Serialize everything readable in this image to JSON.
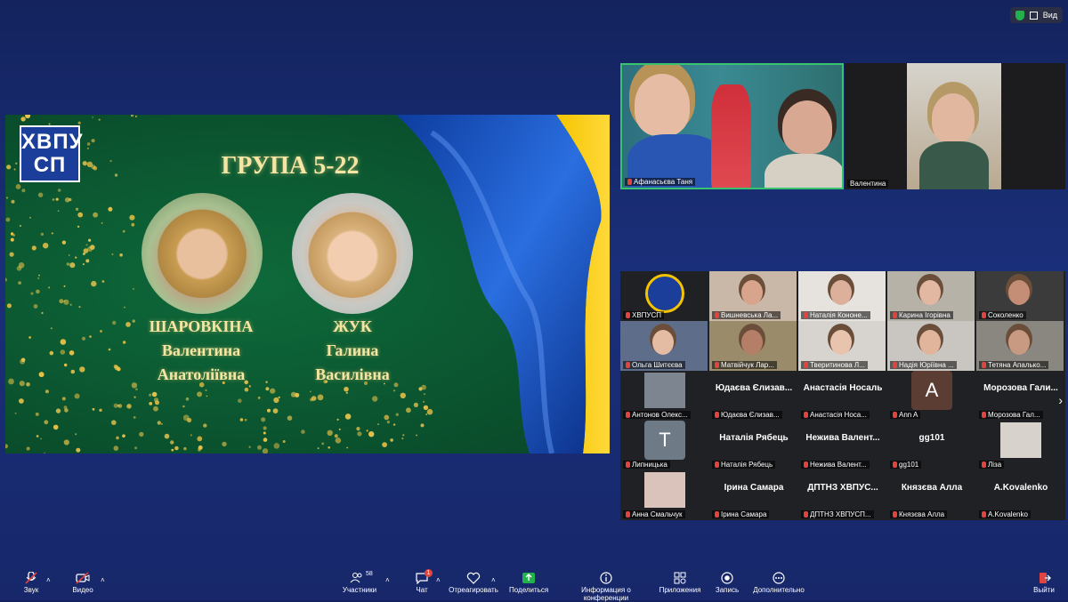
{
  "topbar": {
    "view_label": "Вид"
  },
  "slide": {
    "logo_line1": "ХВПУ",
    "logo_line2": "СП",
    "title": "ГРУПА 5-22",
    "person1": [
      "ШАРОВКІНА",
      "Валентина",
      "Анатоліївна"
    ],
    "person2": [
      "ЖУК",
      "Галина",
      "Василівна"
    ]
  },
  "speakers": [
    {
      "label": "Афанасьєва Таня"
    },
    {
      "label": "Валентина"
    }
  ],
  "gallery": [
    {
      "text": "",
      "label": "ХВПУСП"
    },
    {
      "text": "",
      "label": "Вишневська Ла..."
    },
    {
      "text": "",
      "label": "Наталія Кононе..."
    },
    {
      "text": "",
      "label": "Карина Ігорівна"
    },
    {
      "text": "",
      "label": "Соколенко"
    },
    {
      "text": "",
      "label": "Ольга Шитєєва"
    },
    {
      "text": "",
      "label": "Матвійчук Лар..."
    },
    {
      "text": "",
      "label": "Тверитинова Л..."
    },
    {
      "text": "",
      "label": "Надія Юріївна ..."
    },
    {
      "text": "",
      "label": "Тетяна Апалько..."
    },
    {
      "text": "",
      "label": "Антонов Олекс..."
    },
    {
      "text": "Юдаєва Єлизав...",
      "label": "Юдаєва Єлизав..."
    },
    {
      "text": "Анастасія Носаль",
      "label": "Анастасія Носа..."
    },
    {
      "text": "A",
      "label": "Ann A"
    },
    {
      "text": "Морозова Гали...",
      "label": "Морозова Гал..."
    },
    {
      "text": "T",
      "label": "Липницька"
    },
    {
      "text": "Наталія Рябець",
      "label": "Наталія Рябець"
    },
    {
      "text": "Нежива Валент...",
      "label": "Нежива Валент..."
    },
    {
      "text": "gg101",
      "label": "gg101"
    },
    {
      "text": "",
      "label": "Ліза"
    },
    {
      "text": "",
      "label": "Анна Смальчук"
    },
    {
      "text": "Ірина Самара",
      "label": "Ірина Самара"
    },
    {
      "text": "ДПТНЗ ХВПУС...",
      "label": "ДПТНЗ ХВПУСП..."
    },
    {
      "text": "Князєва Алла",
      "label": "Князєва Алла"
    },
    {
      "text": "A.Kovalenko",
      "label": "A.Kovalenko"
    }
  ],
  "toolbar": {
    "audio": "Звук",
    "video": "Видео",
    "participants": "Участники",
    "participants_count": "58",
    "chat": "Чат",
    "chat_badge": "1",
    "react": "Отреагировать",
    "share": "Поделиться",
    "info": "Информация о конференции",
    "apps": "Приложения",
    "record": "Запись",
    "more": "Дополнительно",
    "leave": "Выйти"
  }
}
